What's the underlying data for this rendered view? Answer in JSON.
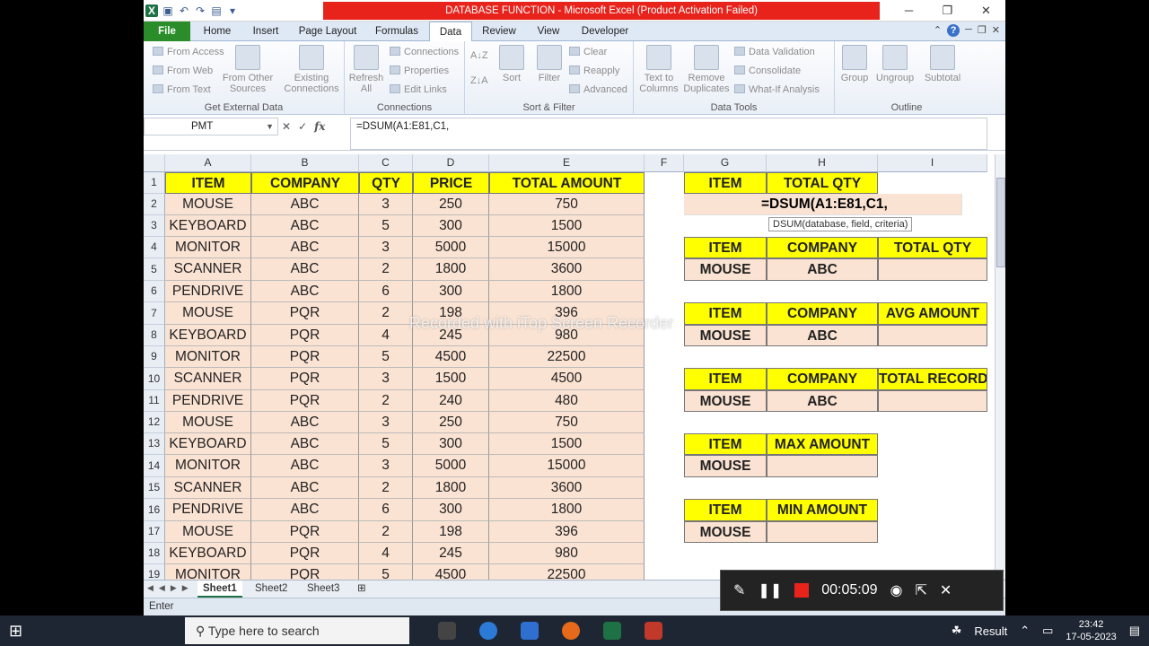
{
  "window": {
    "title": "DATABASE FUNCTION  -  Microsoft Excel (Product Activation Failed)"
  },
  "tabs": [
    "File",
    "Home",
    "Insert",
    "Page Layout",
    "Formulas",
    "Data",
    "Review",
    "View",
    "Developer"
  ],
  "ribbon": {
    "external": {
      "from_access": "From Access",
      "from_web": "From Web",
      "from_text": "From Text",
      "other": "From Other Sources",
      "existing": "Existing Connections",
      "label": "Get External Data"
    },
    "connections": {
      "refresh": "Refresh All",
      "connections": "Connections",
      "properties": "Properties",
      "edit_links": "Edit Links",
      "label": "Connections"
    },
    "sort": {
      "sort": "Sort",
      "filter": "Filter",
      "clear": "Clear",
      "reapply": "Reapply",
      "advanced": "Advanced",
      "label": "Sort & Filter"
    },
    "tools": {
      "ttc": "Text to Columns",
      "remove": "Remove Duplicates",
      "validation": "Data Validation",
      "consolidate": "Consolidate",
      "whatif": "What-If Analysis",
      "label": "Data Tools"
    },
    "outline": {
      "group": "Group",
      "ungroup": "Ungroup",
      "subtotal": "Subtotal",
      "label": "Outline"
    }
  },
  "formula_bar": {
    "name_box": "PMT",
    "formula": "=DSUM(A1:E81,C1,"
  },
  "columns": [
    "A",
    "B",
    "C",
    "D",
    "E",
    "F",
    "G",
    "H",
    "I"
  ],
  "table_headers": [
    "ITEM",
    "COMPANY",
    "QTY",
    "PRICE",
    "TOTAL AMOUNT"
  ],
  "rows": [
    [
      "MOUSE",
      "ABC",
      "3",
      "250",
      "750"
    ],
    [
      "KEYBOARD",
      "ABC",
      "5",
      "300",
      "1500"
    ],
    [
      "MONITOR",
      "ABC",
      "3",
      "5000",
      "15000"
    ],
    [
      "SCANNER",
      "ABC",
      "2",
      "1800",
      "3600"
    ],
    [
      "PENDRIVE",
      "ABC",
      "6",
      "300",
      "1800"
    ],
    [
      "MOUSE",
      "PQR",
      "2",
      "198",
      "396"
    ],
    [
      "KEYBOARD",
      "PQR",
      "4",
      "245",
      "980"
    ],
    [
      "MONITOR",
      "PQR",
      "5",
      "4500",
      "22500"
    ],
    [
      "SCANNER",
      "PQR",
      "3",
      "1500",
      "4500"
    ],
    [
      "PENDRIVE",
      "PQR",
      "2",
      "240",
      "480"
    ],
    [
      "MOUSE",
      "ABC",
      "3",
      "250",
      "750"
    ],
    [
      "KEYBOARD",
      "ABC",
      "5",
      "300",
      "1500"
    ],
    [
      "MONITOR",
      "ABC",
      "3",
      "5000",
      "15000"
    ],
    [
      "SCANNER",
      "ABC",
      "2",
      "1800",
      "3600"
    ],
    [
      "PENDRIVE",
      "ABC",
      "6",
      "300",
      "1800"
    ],
    [
      "MOUSE",
      "PQR",
      "2",
      "198",
      "396"
    ],
    [
      "KEYBOARD",
      "PQR",
      "4",
      "245",
      "980"
    ],
    [
      "MONITOR",
      "PQR",
      "5",
      "4500",
      "22500"
    ]
  ],
  "criteria": {
    "g1": "ITEM",
    "h1": "TOTAL QTY",
    "h2_edit": "=DSUM(A1:E81,C1,",
    "tooltip": "DSUM(database, field, criteria)",
    "b2_item": "ITEM",
    "b2_company": "COMPANY",
    "b2_result": "TOTAL QTY",
    "b2_val_item": "MOUSE",
    "b2_val_company": "ABC",
    "b3_item": "ITEM",
    "b3_company": "COMPANY",
    "b3_result": "AVG AMOUNT",
    "b3_val_item": "MOUSE",
    "b3_val_company": "ABC",
    "b4_item": "ITEM",
    "b4_company": "COMPANY",
    "b4_result": "TOTAL RECORDS",
    "b4_val_item": "MOUSE",
    "b4_val_company": "ABC",
    "b5_item": "ITEM",
    "b5_result": "MAX AMOUNT",
    "b5_val_item": "MOUSE",
    "b6_item": "ITEM",
    "b6_result": "MIN AMOUNT",
    "b6_val_item": "MOUSE"
  },
  "watermark": "Recorded with iTop Screen Recorder",
  "sheets": [
    "Sheet1",
    "Sheet2",
    "Sheet3"
  ],
  "status": "Enter",
  "recorder": {
    "time": "00:05:09"
  },
  "taskbar": {
    "search": "Type here to search",
    "weather": "Result",
    "time": "23:42",
    "date": "17-05-2023"
  }
}
